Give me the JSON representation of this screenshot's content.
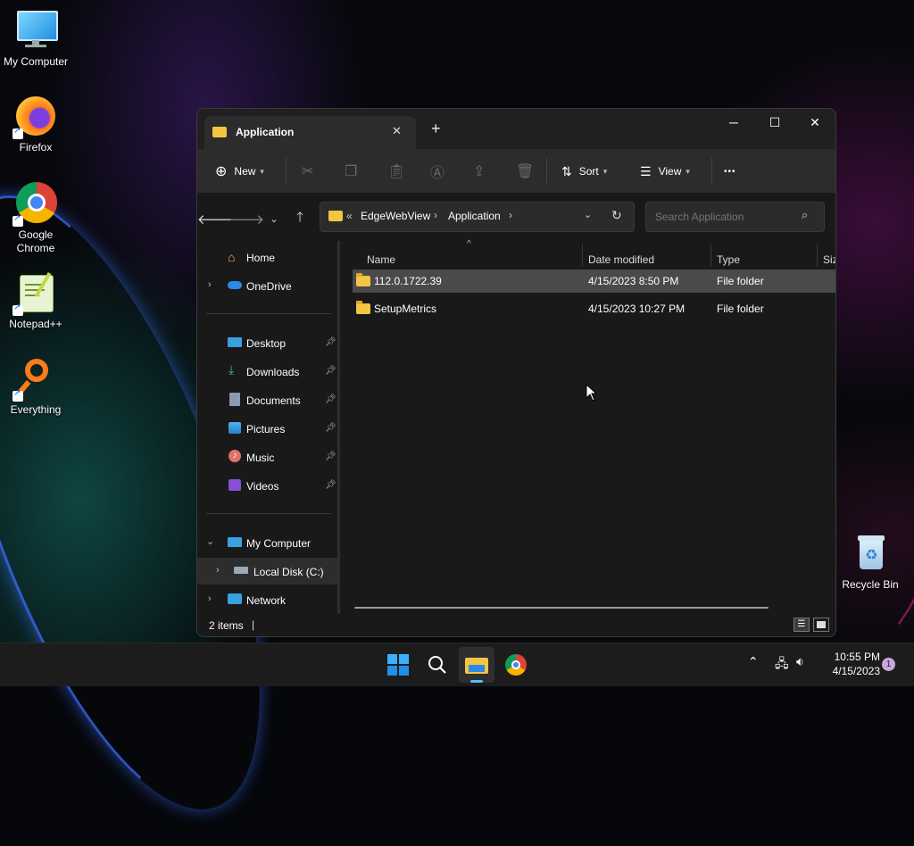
{
  "desktop": {
    "icons": [
      {
        "label": "My Computer"
      },
      {
        "label": "Firefox"
      },
      {
        "label": "Google\nChrome"
      },
      {
        "label": "Notepad++"
      },
      {
        "label": "Everything"
      },
      {
        "label": "Recycle Bin"
      }
    ]
  },
  "explorer": {
    "tab_title": "Application",
    "new_tab_glyph": "+",
    "window_controls": {
      "minimize": "─",
      "maximize": "☐",
      "close": "✕"
    },
    "toolbar": {
      "new_label": "New",
      "sort_label": "Sort",
      "view_label": "View",
      "more_glyph": "•••"
    },
    "address": {
      "overflow": "«",
      "crumbs": [
        "EdgeWebView",
        "Application"
      ],
      "separator": "›"
    },
    "search": {
      "placeholder": "Search Application"
    },
    "sidebar": {
      "home": "Home",
      "onedrive": "OneDrive",
      "quick_access": [
        {
          "label": "Desktop",
          "icon": "desktop-icon"
        },
        {
          "label": "Downloads",
          "icon": "download-icon"
        },
        {
          "label": "Documents",
          "icon": "document-icon"
        },
        {
          "label": "Pictures",
          "icon": "picture-icon"
        },
        {
          "label": "Music",
          "icon": "music-icon"
        },
        {
          "label": "Videos",
          "icon": "video-icon"
        }
      ],
      "my_computer": "My Computer",
      "local_disk": "Local Disk (C:)",
      "network": "Network"
    },
    "columns": {
      "name": "Name",
      "date": "Date modified",
      "type": "Type",
      "size": "Siz"
    },
    "files": [
      {
        "name": "112.0.1722.39",
        "date": "4/15/2023 8:50 PM",
        "type": "File folder",
        "selected": true
      },
      {
        "name": "SetupMetrics",
        "date": "4/15/2023 10:27 PM",
        "type": "File folder",
        "selected": false
      }
    ],
    "status": {
      "items": "2 items",
      "separator": "|"
    }
  },
  "taskbar": {
    "time": "10:55 PM",
    "date": "4/15/2023",
    "notification_count": "1"
  },
  "colors": {
    "accent": "#4cc2ff",
    "folder": "#f4c542",
    "selection": "#4a4a4a"
  }
}
